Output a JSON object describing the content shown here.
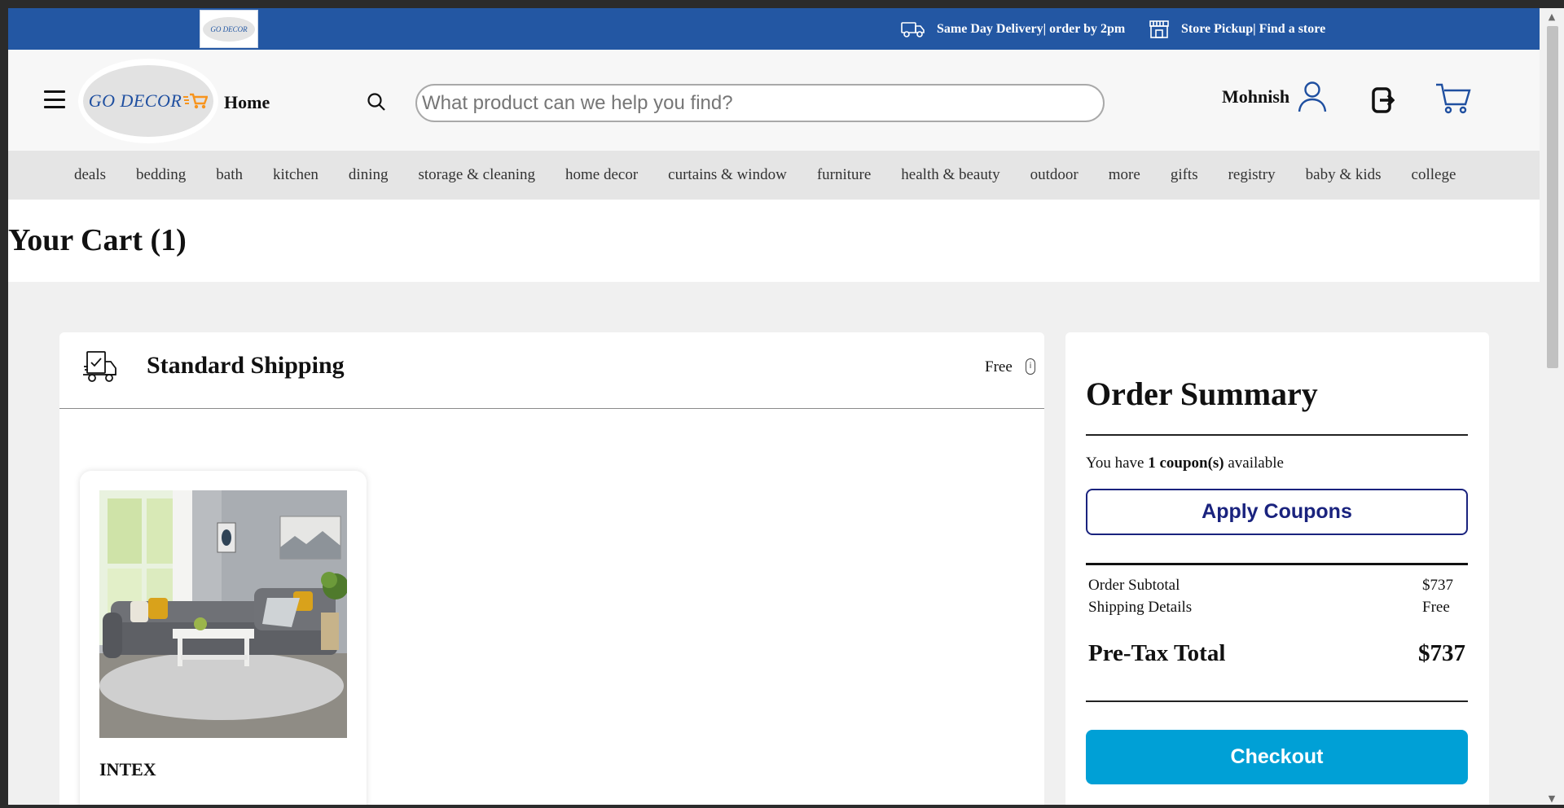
{
  "topbar": {
    "mini_logo_text": "GO DECOR",
    "delivery_text": "Same Day Delivery| order by 2pm",
    "pickup_text": "Store Pickup| Find a store"
  },
  "header": {
    "logo_text": "GO DECOR",
    "home_label": "Home",
    "search_placeholder": "What product can we help you find?",
    "user_name": "Mohnish"
  },
  "categories": [
    "deals",
    "bedding",
    "bath",
    "kitchen",
    "dining",
    "storage & cleaning",
    "home decor",
    "curtains & window",
    "furniture",
    "health & beauty",
    "outdoor",
    "more",
    "gifts",
    "registry",
    "baby & kids",
    "college"
  ],
  "cart": {
    "title": "Your Cart (1)",
    "shipping_title": "Standard Shipping",
    "shipping_price": "Free",
    "info_icon_glyph": "i",
    "product_name": "INTEX"
  },
  "summary": {
    "title": "Order Summary",
    "coupon_prefix": "You have ",
    "coupon_count": "1 coupon(s)",
    "coupon_suffix": " available",
    "apply_label": "Apply Coupons",
    "subtotal_label": "Order Subtotal",
    "subtotal_value": "$737",
    "shipping_label": "Shipping Details",
    "shipping_value": "Free",
    "total_label": "Pre-Tax Total",
    "total_value": "$737",
    "checkout_label": "Checkout"
  },
  "scrollbar": {
    "up_glyph": "▲",
    "down_glyph": "▼"
  },
  "colors": {
    "brand_blue": "#2357a3",
    "checkout": "#00a0d6",
    "coupon_navy": "#1a237e"
  }
}
